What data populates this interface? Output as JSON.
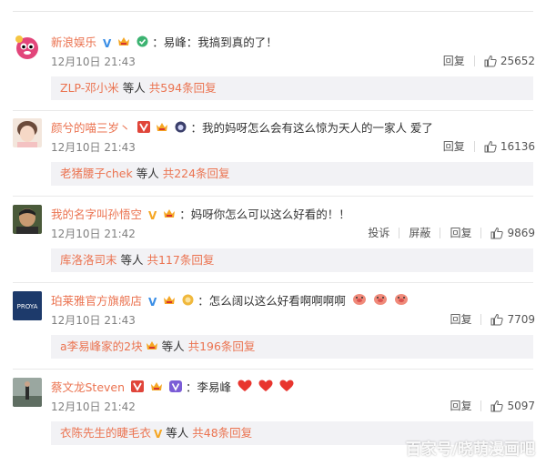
{
  "colors": {
    "accent": "#eb7350",
    "text": "#333333",
    "muted": "#808080",
    "reply_bg": "#f2f2f5",
    "heart": "#e8352e"
  },
  "comments": [
    {
      "user": "新浪娱乐",
      "badges": [
        "verified-blue-icon",
        "vip-crown-icon",
        "green-check-icon"
      ],
      "text": "：易峰：我搞到真的了！",
      "time": "12月10日 21:43",
      "actions": [
        "回复"
      ],
      "likes": "25652",
      "reply": {
        "user": "ZLP-邓小米",
        "middle": " 等人 ",
        "count": "共594条回复"
      }
    },
    {
      "user": "颜兮的喵三岁丶",
      "badges": [
        "verified-red-icon",
        "vip-crown-icon",
        "cat-badge-icon"
      ],
      "text": "：我的妈呀怎么会有这么惊为天人的一家人 爱了",
      "time": "12月10日 21:43",
      "actions": [
        "回复"
      ],
      "likes": "16136",
      "reply": {
        "user": "老猪腰子chek",
        "middle": " 等人 ",
        "count": "共224条回复"
      }
    },
    {
      "user": "我的名字叫孙悟空",
      "badges": [
        "verified-orange-icon",
        "vip-crown-icon"
      ],
      "text": "：妈呀你怎么可以这么好看的！！",
      "time": "12月10日 21:42",
      "actions": [
        "投诉",
        "屏蔽",
        "回复"
      ],
      "likes": "9869",
      "reply": {
        "user": "库洛洛司末",
        "middle": " 等人 ",
        "count": "共117条回复"
      }
    },
    {
      "user": "珀莱雅官方旗舰店",
      "badges": [
        "verified-blue-icon",
        "vip-crown-icon",
        "medal-icon"
      ],
      "text": "：怎么阔以这么好看啊啊啊啊",
      "emoji": [
        "pig-face-icon",
        "pig-face-icon",
        "pig-face-icon"
      ],
      "time": "12月10日 21:43",
      "actions": [
        "回复"
      ],
      "likes": "7709",
      "reply": {
        "user": "a李易峰家的2块",
        "middle": " 等人 ",
        "count": "共196条回复",
        "reply_badge": "vip-crown-icon"
      },
      "avatar_text": "PROYA"
    },
    {
      "user": "蔡文龙Steven",
      "badges": [
        "verified-red-icon",
        "vip-crown-icon",
        "purple-badge-icon"
      ],
      "text": "：李易峰",
      "emoji": [
        "heart-icon",
        "heart-icon",
        "heart-icon"
      ],
      "time": "12月10日 21:42",
      "actions": [
        "回复"
      ],
      "likes": "5097",
      "reply": {
        "user": "衣陈先生的睫毛衣",
        "middle": " 等人 ",
        "count": "共48条回复",
        "reply_badge": "verified-orange-icon"
      }
    }
  ],
  "watermark": "百家号/晓萌漫画吧"
}
